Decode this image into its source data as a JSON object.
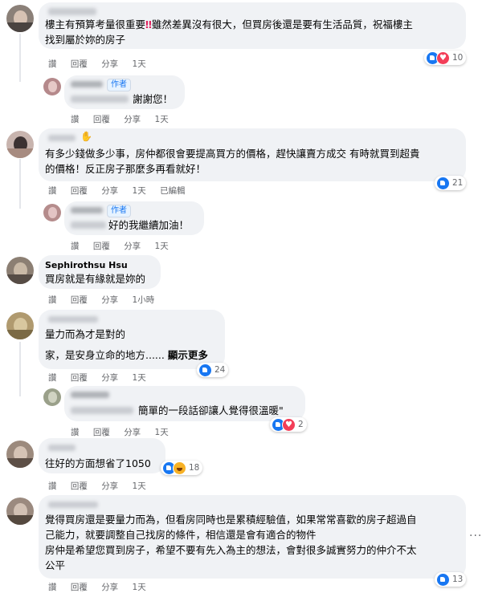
{
  "ui": {
    "colors": {
      "bubble": "#f0f2f5",
      "link": "#1877f2",
      "muted": "#65676b",
      "like": "#1877f2",
      "love": "#f33e58",
      "haha": "#f7b125"
    },
    "author_badge": "作者",
    "see_more": "顯示更多",
    "more_options_icon": "more-horizontal-icon"
  },
  "comments": [
    {
      "text_line1": "樓主有預算考量很重要",
      "warn_icon": "‼️",
      "text_line1b": "雖然差異沒有很大，但買房後還是要有生活品質，祝福樓主",
      "text_line2": "找到屬於妳的房子",
      "actions": [
        "讚",
        "回覆",
        "分享",
        "1天"
      ],
      "reactions": {
        "icons": [
          "like-icon",
          "love-icon"
        ],
        "count": "10"
      },
      "reply": {
        "text": "謝謝您！",
        "actions": [
          "讚",
          "回覆",
          "分享",
          "1天"
        ]
      }
    },
    {
      "name_icon": "waving-hand-icon",
      "text_line1": "有多少錢做多少事，房仲都很會要提高買方的價格，趕快讓賣方成交 有時就買到超貴",
      "text_line2": "的價格！反正房子那麼多再看就好！",
      "actions": [
        "讚",
        "回覆",
        "分享",
        "1天",
        "已編輯"
      ],
      "reactions": {
        "icons": [
          "like-icon"
        ],
        "count": "21"
      },
      "reply": {
        "text": "好的我繼續加油！",
        "actions": [
          "讚",
          "回覆",
          "分享",
          "1天"
        ]
      }
    },
    {
      "name": "Sephirothsu Hsu",
      "text_line1": "買房就是有緣就是妳的",
      "actions": [
        "讚",
        "回覆",
        "分享",
        "1小時"
      ]
    },
    {
      "text_line1": "量力而為才是對的",
      "text_line2": "家，是安身立命的地方......",
      "actions": [
        "讚",
        "回覆",
        "分享",
        "1天"
      ],
      "reactions": {
        "icons": [
          "like-icon"
        ],
        "count": "24"
      },
      "reply": {
        "text": "簡單的一段話卻讓人覺得很溫暖\"",
        "actions": [
          "讚",
          "回覆",
          "分享",
          "1天"
        ],
        "reactions": {
          "icons": [
            "like-icon",
            "love-icon"
          ],
          "count": "2"
        }
      }
    },
    {
      "text_line1": "往好的方面想省了1050",
      "actions": [
        "讚",
        "回覆",
        "分享",
        "1天"
      ],
      "reactions": {
        "icons": [
          "like-icon",
          "haha-icon"
        ],
        "count": "18"
      }
    },
    {
      "text_line1": "覺得買房還是要量力而為，但看房同時也是累積經驗值，如果常常喜歡的房子超過自",
      "text_line2": "己能力，就要調整自己找房的條件，相信還是會有適合的物件",
      "text_line3": "房仲是希望您買到房子，希望不要有先入為主的想法，會對很多誠實努力的仲介不太",
      "text_line4": "公平",
      "reactions": {
        "icons": [
          "like-icon"
        ],
        "count": "13"
      },
      "actions": [
        "讚",
        "回覆",
        "分享",
        "1天"
      ]
    }
  ]
}
